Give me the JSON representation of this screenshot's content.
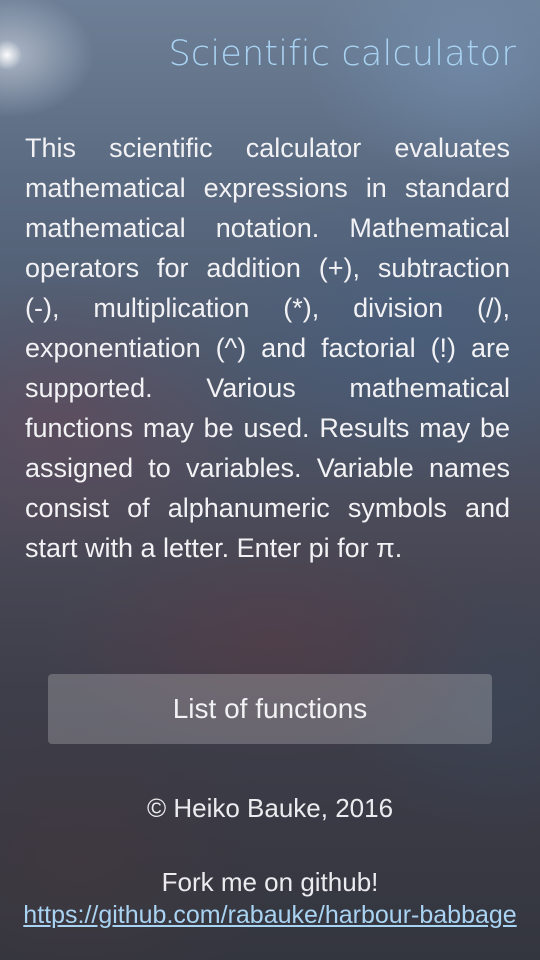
{
  "page": {
    "title": "Scientific calculator",
    "description": "This scientific calculator evaluates mathematical expressions in standard mathematical notation. Mathematical operators for addition (+), subtraction (-), multiplication (*), division (/), exponentiation (^) and factorial (!) are supported.  Various mathematical functions may be used. Results may be assigned to variables. Variable names consist of alphanumeric symbols and start with a letter.  Enter pi for π."
  },
  "actions": {
    "list_functions_label": "List of functions"
  },
  "footer": {
    "copyright": "© Heiko Bauke, 2016",
    "fork_text": "Fork me on github!",
    "repo_link": "https://github.com/rabauke/harbour-babbage"
  },
  "colors": {
    "title_accent": "#a9d3f2",
    "link": "#a9d3f2",
    "text": "#f2f2f5"
  }
}
